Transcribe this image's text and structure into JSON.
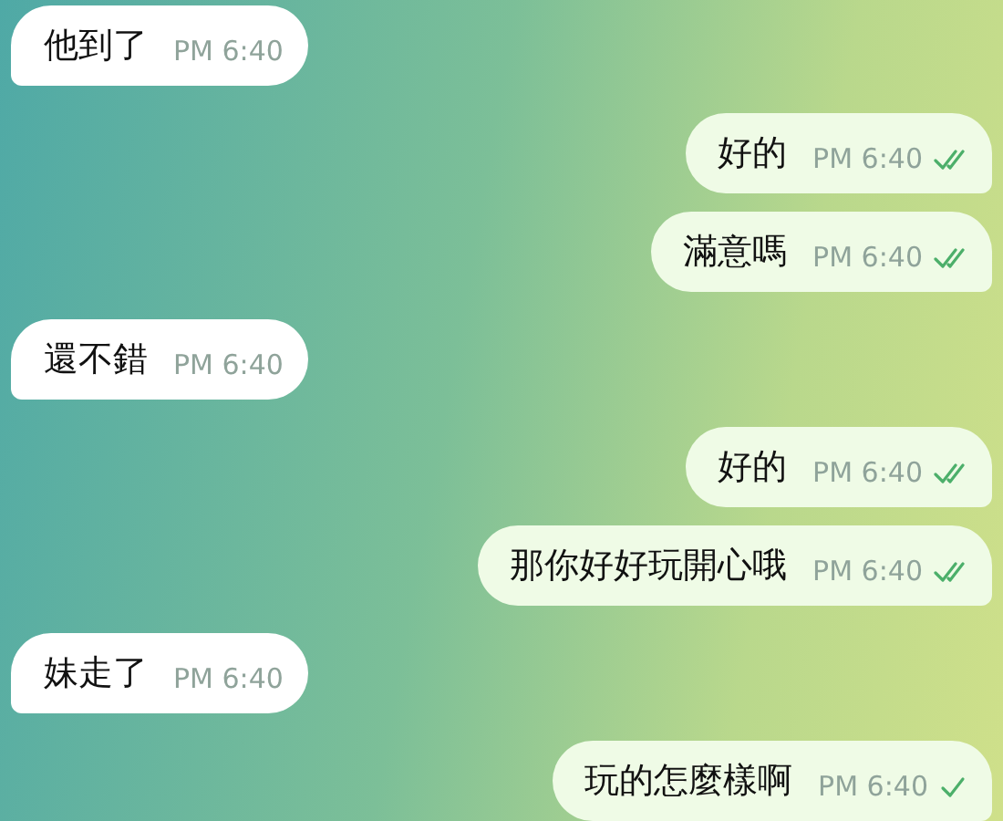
{
  "messages": [
    {
      "kind": "incoming",
      "text": "他到了",
      "time": "PM 6:40"
    },
    {
      "kind": "outgoing",
      "text": "好的",
      "time": "PM 6:40",
      "read": true
    },
    {
      "kind": "outgoing",
      "text": "滿意嗎",
      "time": "PM 6:40",
      "read": true
    },
    {
      "kind": "incoming",
      "text": "還不錯",
      "time": "PM 6:40"
    },
    {
      "kind": "outgoing",
      "text": "好的",
      "time": "PM 6:40",
      "read": true
    },
    {
      "kind": "outgoing",
      "text": "那你好好玩開心哦",
      "time": "PM 6:40",
      "read": true
    },
    {
      "kind": "incoming",
      "text": "妹走了",
      "time": "PM 6:40"
    },
    {
      "kind": "outgoing",
      "text": "玩的怎麼樣啊",
      "time": "PM 6:40",
      "read": false
    }
  ]
}
